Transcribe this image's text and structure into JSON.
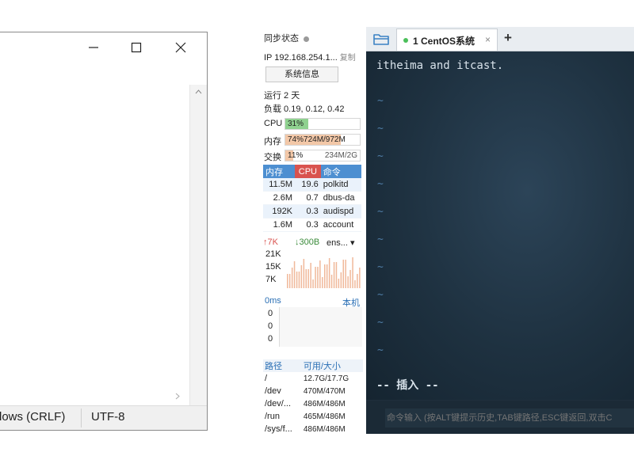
{
  "notepad": {
    "status_eol": "lows (CRLF)",
    "status_encoding": "UTF-8"
  },
  "side": {
    "sync_label": "同步状态",
    "ip": "IP 192.168.254.1...",
    "ip_copy": "复制",
    "sysinfo_button": "系统信息",
    "uptime": "运行 2 天",
    "load": "负载 0.19, 0.12, 0.42",
    "cpu": {
      "label": "CPU",
      "text": "31%",
      "percent": 31
    },
    "mem": {
      "label": "内存",
      "text": "74%724M/972M",
      "percent": 74
    },
    "swap": {
      "label": "交换",
      "text": "11%",
      "text2": "234M/2G",
      "percent": 11
    },
    "proc_headers": [
      "内存",
      "CPU",
      "命令"
    ],
    "processes": [
      {
        "mem": "11.5M",
        "cpu": "19.6",
        "cmd": "polkitd"
      },
      {
        "mem": "2.6M",
        "cpu": "0.7",
        "cmd": "dbus-da"
      },
      {
        "mem": "192K",
        "cpu": "0.3",
        "cmd": "audispd"
      },
      {
        "mem": "1.6M",
        "cpu": "0.3",
        "cmd": "account"
      }
    ],
    "net": {
      "up": "↑7K",
      "down": "↓300B",
      "iface": "ens...",
      "ticks": [
        "21K",
        "15K",
        "7K"
      ]
    },
    "ping": {
      "unit": "0ms",
      "host": "本机",
      "values": [
        "0",
        "0",
        "0"
      ]
    },
    "disk_headers": [
      "路径",
      "可用/大小"
    ],
    "disks": [
      {
        "path": "/",
        "size": "12.7G/17.7G"
      },
      {
        "path": "/dev",
        "size": "470M/470M"
      },
      {
        "path": "/dev/...",
        "size": "486M/486M"
      },
      {
        "path": "/run",
        "size": "465M/486M"
      },
      {
        "path": "/sys/f...",
        "size": "486M/486M"
      }
    ]
  },
  "terminal": {
    "tab_label": "1 CentOS系统",
    "tab_close": "×",
    "add_tab": "+",
    "line1": "itheima and itcast.",
    "insert_mode": "-- 插入 --",
    "cmd_placeholder": "命令输入 (按ALT键提示历史,TAB键路径,ESC键返回,双击C"
  }
}
